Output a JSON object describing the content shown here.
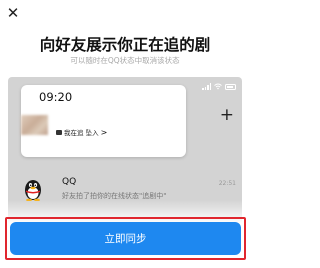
{
  "dialog": {
    "close_glyph": "✕",
    "title": "向好友展示你正在追的剧",
    "subtitle": "可以随时在QQ状态中取消该状态"
  },
  "preview": {
    "notification": {
      "time": "09:20",
      "status_text": "我在追 坠入",
      "chevron": ">"
    },
    "plus_glyph": "+",
    "chat": {
      "name": "QQ",
      "message": "好友拍了拍你的在线状态\"追剧中\"",
      "time": "22:51"
    }
  },
  "action": {
    "sync_label": "立即同步"
  },
  "colors": {
    "accent": "#1e88f0",
    "highlight_border": "#e0262e",
    "preview_bg": "#d3d3d3"
  }
}
